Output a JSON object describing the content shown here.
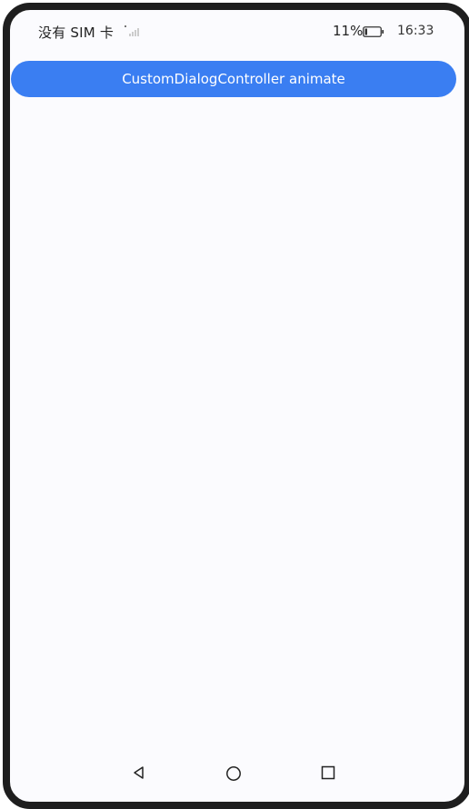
{
  "status_bar": {
    "carrier": "没有 SIM 卡",
    "battery_percent": "11%",
    "time": "16:33",
    "icons": [
      "signal-icon",
      "battery-icon"
    ]
  },
  "main": {
    "button_label": "CustomDialogController animate"
  },
  "nav_bar": {
    "icons": [
      "back-icon",
      "home-icon",
      "recents-icon"
    ]
  },
  "colors": {
    "accent": "#3a7ef2",
    "background": "#fbfbfe",
    "frame": "#1e1e1e"
  }
}
